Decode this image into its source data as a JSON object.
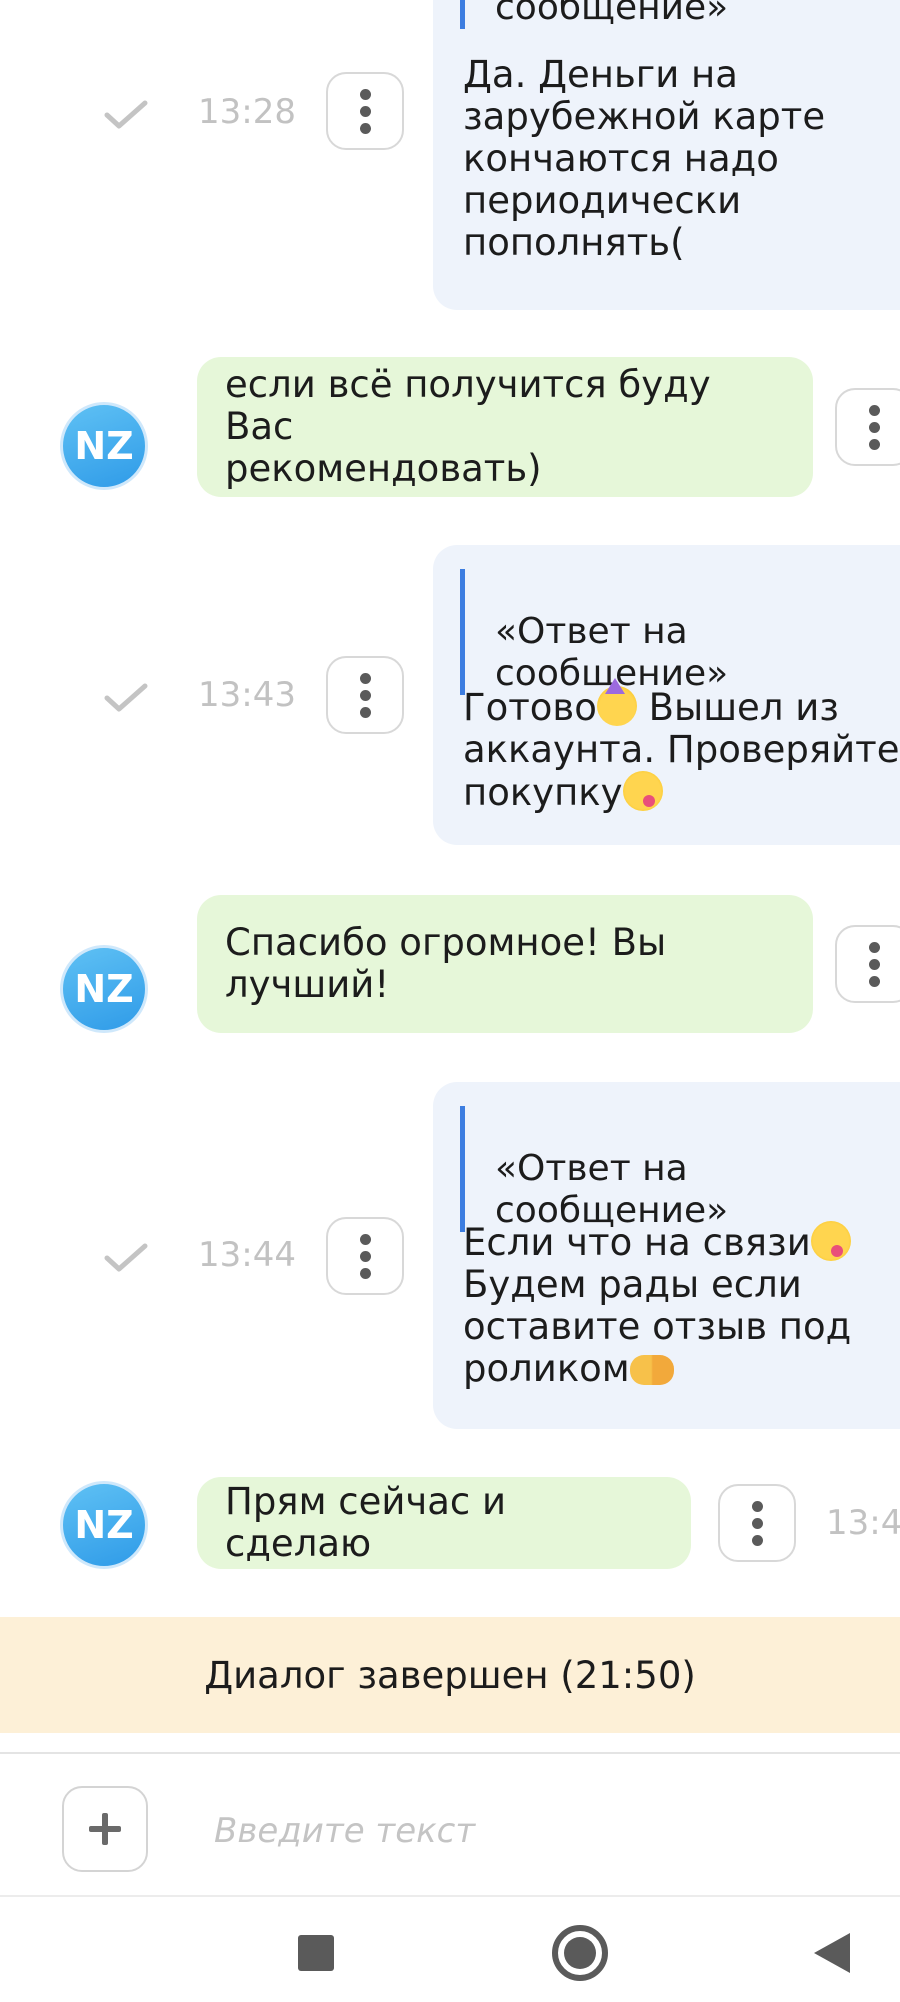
{
  "messages": [
    {
      "side": "out",
      "quote": "сообщение»",
      "text": "Да. Деньги на\nзарубежной карте\nкончаются надо\nпериодически\nпополнять(",
      "time": "13:28"
    },
    {
      "side": "in",
      "avatar": "NZ",
      "text": "если всё получится буду Вас\nрекомендовать)"
    },
    {
      "side": "out",
      "quote": "«Ответ на\nсообщение»",
      "text_line1": "Готово",
      "text_line1b": " Вышел из",
      "text_line2": "аккаунта. Проверяйте",
      "text_line3": "покупку",
      "time": "13:43"
    },
    {
      "side": "in",
      "avatar": "NZ",
      "text": "Спасибо огромное! Вы\nлучший!"
    },
    {
      "side": "out",
      "quote": "«Ответ на\nсообщение»",
      "text_line1": "Если что на связи",
      "text_line2": "Будем рады если",
      "text_line3": "оставите отзыв под",
      "text_line4": "роликом",
      "time": "13:44"
    },
    {
      "side": "in",
      "avatar": "NZ",
      "text": "Прям сейчас и сделаю",
      "time": "13:4"
    }
  ],
  "banner": {
    "text": "Диалог завершен (21:50)"
  },
  "composer": {
    "placeholder": "Введите текст"
  },
  "icons": {
    "check": "check-icon",
    "more": "more-vertical-icon",
    "plus": "plus-icon",
    "nav_recent": "square-icon",
    "nav_home": "circle-icon",
    "nav_back": "triangle-back-icon"
  },
  "colors": {
    "outgoing_bubble": "#eef3fb",
    "incoming_bubble": "#e6f7d9",
    "quote_bar": "#3d7de0",
    "banner_bg": "#fdf0d7",
    "avatar": "#3aa6ec"
  }
}
